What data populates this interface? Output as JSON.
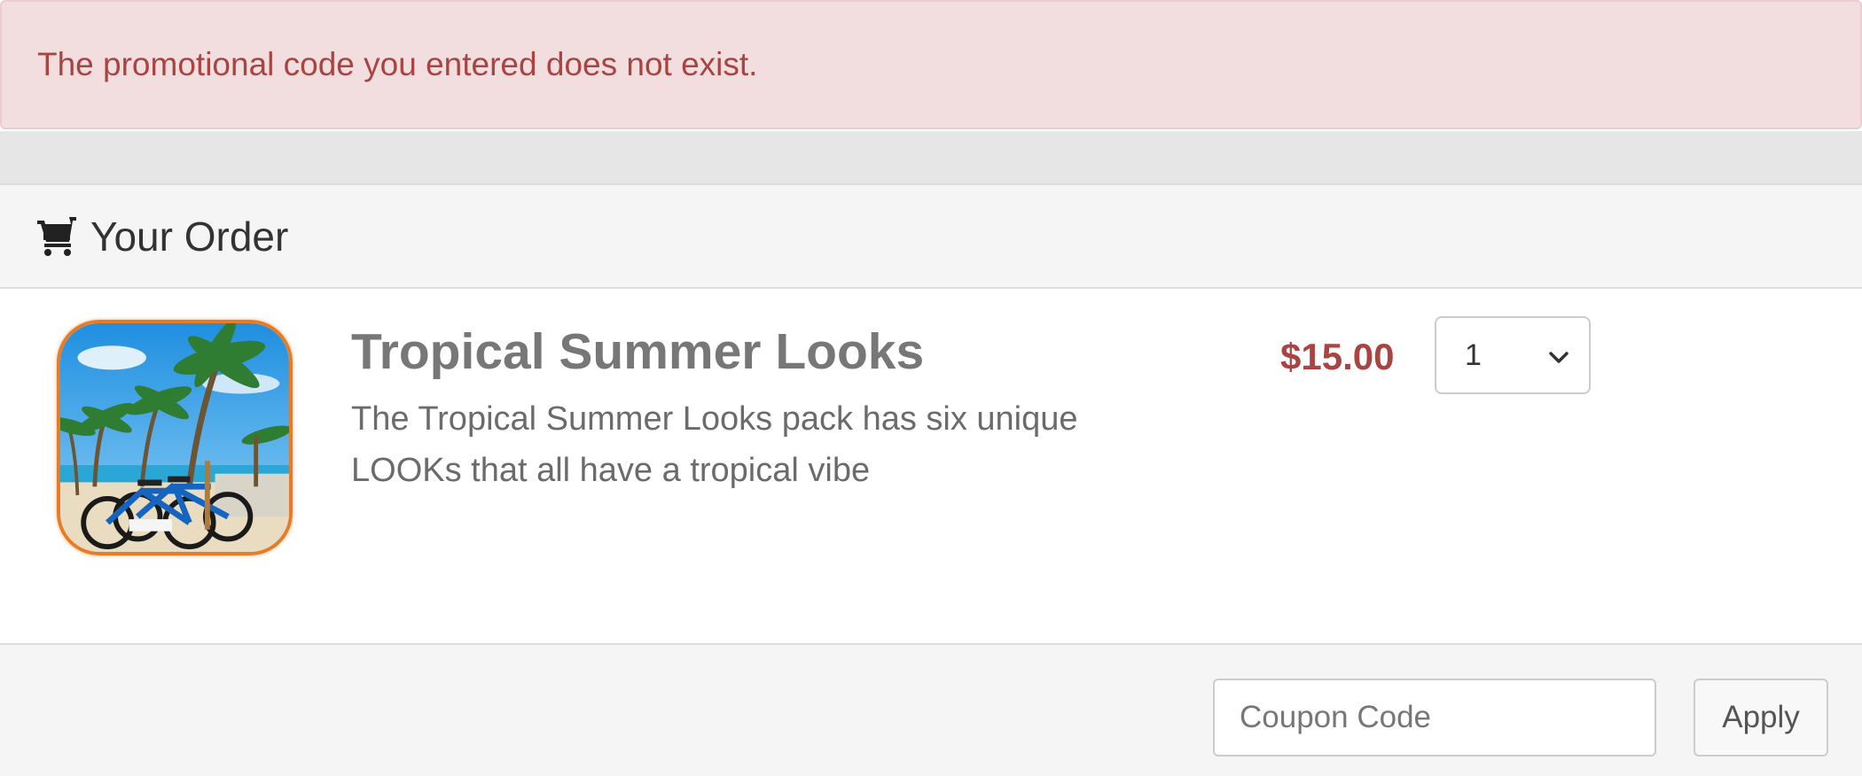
{
  "alert": {
    "message": "The promotional code you entered does not exist."
  },
  "order": {
    "heading": "Your Order",
    "heading_icon": "shopping-cart-icon"
  },
  "item": {
    "image_alt": "Bicycles parked by palm trees on a tropical beach",
    "title": "Tropical Summer Looks",
    "description": "The Tropical Summer Looks pack has six unique LOOKs that all have a tropical vibe",
    "price": "$15.00",
    "quantity": "1"
  },
  "coupon": {
    "placeholder": "Coupon Code",
    "apply_label": "Apply"
  },
  "colors": {
    "alert_bg": "#f2dede",
    "alert_text": "#a94442",
    "price": "#a94442",
    "image_border": "#e87c26"
  }
}
